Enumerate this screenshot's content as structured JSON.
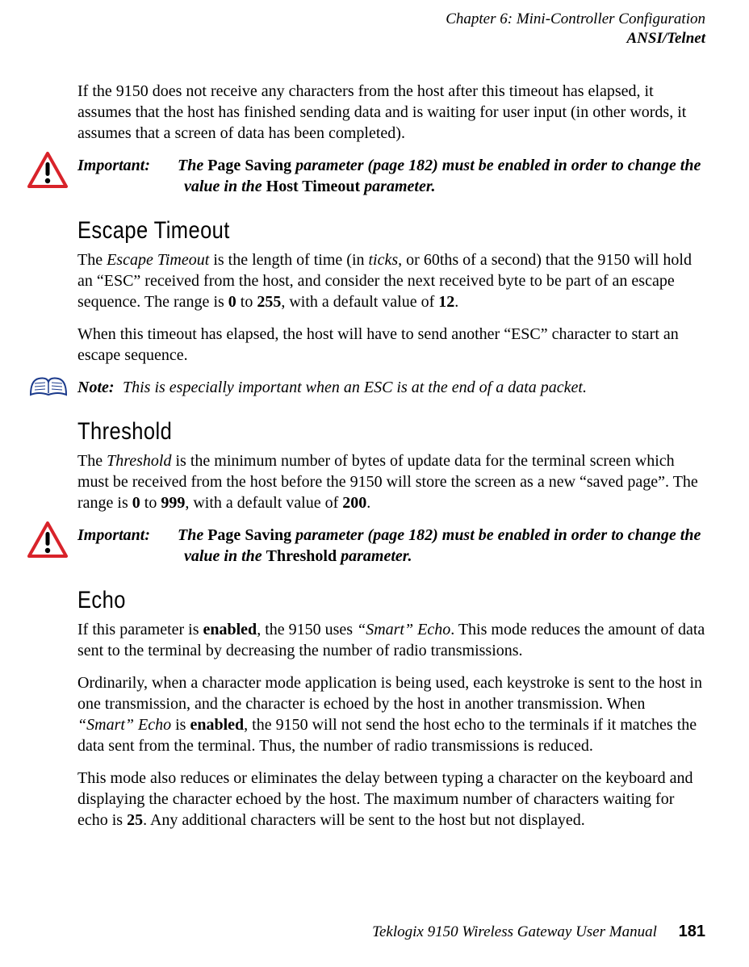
{
  "header": {
    "chapter": "Chapter 6:  Mini-Controller Configuration",
    "section": "ANSI/Telnet"
  },
  "intro_para": "If the 9150 does not receive any characters from the host after this timeout has elapsed, it assumes that the host has finished sending data and is waiting for user input (in other words, it assumes that a screen of data has been completed).",
  "important1": {
    "label": "Important:",
    "t1": "The ",
    "b1": "Page Saving",
    "t2": " parameter (page 182) must be enabled in order to change the value in the ",
    "b2": "Host Timeout",
    "t3": " parameter."
  },
  "escape": {
    "heading": "Escape Timeout",
    "p1a": "The ",
    "p1i": "Escape Timeout",
    "p1b": " is the length of time (in ",
    "p1i2": "ticks",
    "p1c": ", or 60ths of a second) that the 9150 will hold an “ESC” received from the host, and consider the next received byte to be part of an escape sequence. The range is ",
    "p1d": "0",
    "p1e": " to ",
    "p1f": "255",
    "p1g": ", with a default value of ",
    "p1h": "12",
    "p1j": ".",
    "p2": "When this timeout has elapsed, the host will have to send another “ESC” character to start an escape sequence."
  },
  "note": {
    "label": "Note:",
    "text": "This is especially important when an ESC is at the end of a data packet."
  },
  "threshold": {
    "heading": "Threshold",
    "p1a": "The ",
    "p1i": "Threshold",
    "p1b": " is the minimum number of bytes of update data for the terminal screen which must be received from the host before the 9150 will store the screen as a new “saved page”. The range is ",
    "p1c": "0",
    "p1d": " to ",
    "p1e": "999",
    "p1f": ", with a default value of ",
    "p1g": "200",
    "p1h": "."
  },
  "important2": {
    "label": "Important:",
    "t1": "The ",
    "b1": "Page Saving",
    "t2": " parameter (page 182) must be enabled in order to change the value in the ",
    "b2": "Threshold",
    "t3": " parameter."
  },
  "echo": {
    "heading": "Echo",
    "p1a": "If this parameter is ",
    "p1b": "enabled",
    "p1c": ", the 9150 uses ",
    "p1i": "“Smart” Echo",
    "p1d": ". This mode reduces the amount of data sent to the terminal by decreasing the number of radio transmissions.",
    "p2a": "Ordinarily, when a character mode application is being used, each keystroke is sent to the host in one transmission, and the character is echoed by the host in another transmission. When ",
    "p2i": "“Smart” Echo",
    "p2b": " is ",
    "p2c": "enabled",
    "p2d": ", the 9150 will not send the host echo to the terminals if it matches the data sent from the terminal. Thus, the number of radio transmissions is reduced.",
    "p3a": "This mode also reduces or eliminates the delay between typing a character on the keyboard and displaying the character echoed by the host. The maximum number of characters waiting for echo is ",
    "p3b": "25",
    "p3c": ". Any additional characters will be sent to the host but not displayed."
  },
  "footer": {
    "book": "Teklogix 9150 Wireless Gateway User Manual",
    "page": "181"
  }
}
